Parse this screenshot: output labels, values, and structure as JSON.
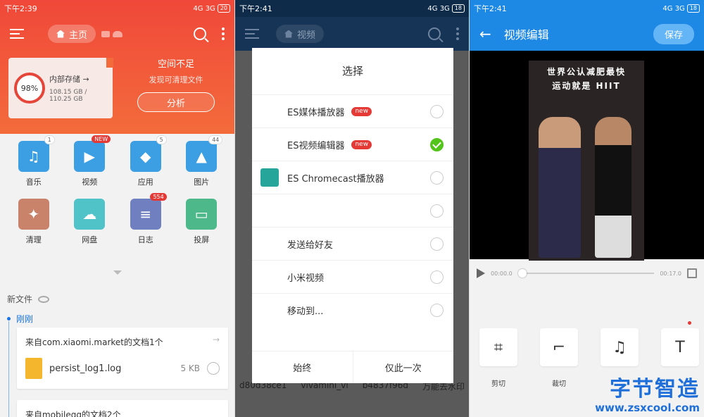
{
  "panel1": {
    "status": {
      "time": "下午2:39",
      "network": "4G 3G",
      "battery": "20"
    },
    "toolbar": {
      "home_label": "主页"
    },
    "storage": {
      "percent": "98%",
      "title": "内部存储 →",
      "usage": "108.15 GB / 110.25 GB"
    },
    "warning": {
      "title": "空间不足",
      "subtitle": "发现可清理文件",
      "button": "分析"
    },
    "apps": [
      {
        "label": "音乐",
        "badge": "1",
        "color": "#3d9fe3",
        "glyph": "♫"
      },
      {
        "label": "视频",
        "badge": "NEW",
        "color": "#3d9fe3",
        "glyph": "▶"
      },
      {
        "label": "应用",
        "badge": "5",
        "color": "#3d9fe3",
        "glyph": "◆"
      },
      {
        "label": "图片",
        "badge": "44",
        "color": "#3d9fe3",
        "glyph": "▲"
      },
      {
        "label": "清理",
        "badge": "",
        "color": "#c9836a",
        "glyph": "✦"
      },
      {
        "label": "网盘",
        "badge": "",
        "color": "#4fc3c7",
        "glyph": "☁"
      },
      {
        "label": "日志",
        "badge": "554",
        "color": "#6f7fc0",
        "glyph": "≡"
      },
      {
        "label": "投屏",
        "badge": "",
        "color": "#4db88a",
        "glyph": "▭"
      }
    ],
    "new_files_label": "新文件",
    "just_now_label": "刚刚",
    "cards": [
      {
        "title": "来自com.xiaomi.market的文档1个",
        "file_name": "persist_log1.log",
        "file_size": "5 KB"
      },
      {
        "title": "来自mobileqq的文档2个"
      }
    ]
  },
  "panel2": {
    "status": {
      "time": "下午2:41",
      "network": "4G 3G",
      "battery": "18"
    },
    "toolbar": {
      "tab_label": "视频"
    },
    "dialog": {
      "title": "选择",
      "options": [
        {
          "label": "ES媒体播放器",
          "badge": "new",
          "selected": false
        },
        {
          "label": "ES视频编辑器",
          "badge": "new",
          "selected": true
        },
        {
          "label": "ES Chromecast播放器",
          "badge": "",
          "selected": false
        },
        {
          "label": "",
          "badge": "",
          "selected": false
        },
        {
          "label": "发送给好友",
          "badge": "",
          "selected": false
        },
        {
          "label": "小米视频",
          "badge": "",
          "selected": false
        },
        {
          "label": "移动到...",
          "badge": "",
          "selected": false
        }
      ],
      "always": "始终",
      "just_once": "仅此一次"
    },
    "bg_thumbs": [
      "d80d38ce1",
      "vivamini_vi",
      "b4837f96d",
      "万能去水印"
    ]
  },
  "panel3": {
    "status": {
      "time": "下午2:41",
      "network": "4G 3G",
      "battery": "18"
    },
    "title": "视频编辑",
    "save_label": "保存",
    "video_caption": [
      "世界公认减肥最快",
      "运动就是 HIIT"
    ],
    "time_start": "00:00.0",
    "time_end": "00:17.0",
    "tools": [
      {
        "label": "剪切",
        "glyph": "⌗"
      },
      {
        "label": "裁切",
        "glyph": "⌐"
      },
      {
        "label": "",
        "glyph": "♫"
      },
      {
        "label": "",
        "glyph": "T"
      }
    ],
    "watermark": {
      "line1": "字节智造",
      "line2": "www.zsxcool.com"
    }
  }
}
